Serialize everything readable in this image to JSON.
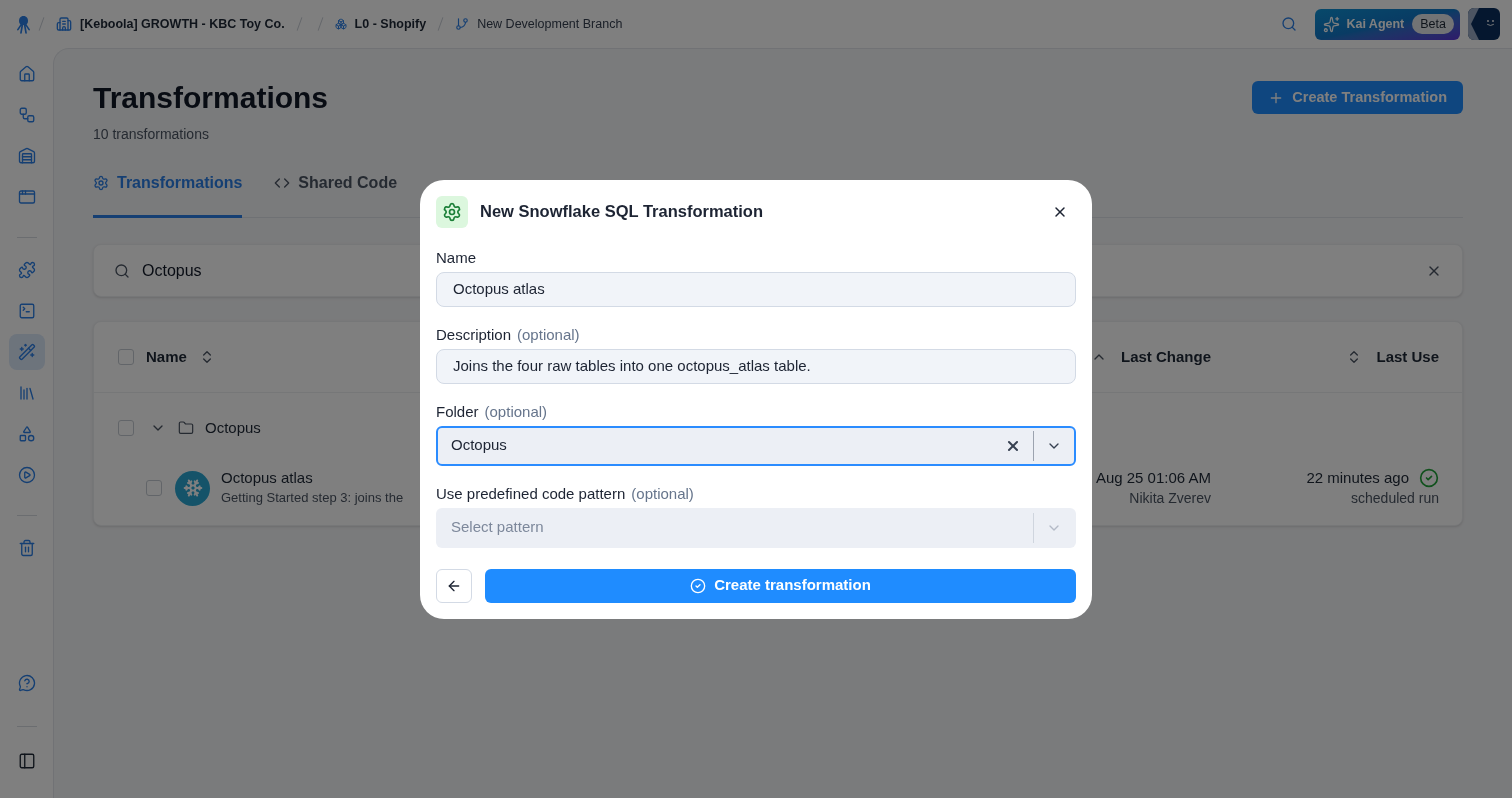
{
  "topbar": {
    "breadcrumbs": [
      {
        "kind": "project",
        "label": "[Keboola] GROWTH - KBC Toy Co."
      },
      {
        "kind": "configuration",
        "label": "L0 - Shopify"
      },
      {
        "kind": "branch",
        "label": "New Development Branch"
      }
    ],
    "agent_button": {
      "label": "Kai Agent",
      "badge": "Beta"
    }
  },
  "sidebar": {
    "top_groups": [
      [
        {
          "kind": "home",
          "selected": false
        },
        {
          "kind": "flows",
          "selected": false
        },
        {
          "kind": "storage",
          "selected": false
        },
        {
          "kind": "workspaces",
          "selected": false
        }
      ],
      [
        {
          "kind": "components",
          "selected": false
        },
        {
          "kind": "terminal",
          "selected": false
        },
        {
          "kind": "transformations",
          "selected": true
        },
        {
          "kind": "library",
          "selected": false
        },
        {
          "kind": "shapes",
          "selected": false
        },
        {
          "kind": "jobs",
          "selected": false
        }
      ],
      [
        {
          "kind": "trash",
          "selected": false
        }
      ]
    ],
    "bottom_groups": [
      [
        {
          "kind": "help"
        }
      ],
      [
        {
          "kind": "panel"
        }
      ]
    ]
  },
  "page": {
    "title": "Transformations",
    "subtitle": "10 transformations",
    "create_button": "Create Transformation"
  },
  "tabs": [
    {
      "kind": "gear",
      "label": "Transformations",
      "selected": true
    },
    {
      "kind": "code",
      "label": "Shared Code",
      "selected": false
    }
  ],
  "search": {
    "value": "Octopus"
  },
  "table": {
    "select_all_checked": false,
    "columns": [
      {
        "label": "Name",
        "sorted": false
      },
      {
        "label": "Last Change",
        "sorted": true,
        "descending": false
      },
      {
        "label": "Last Use",
        "sorted": false
      }
    ],
    "rows": [
      {
        "kind": "folder",
        "name": "Octopus",
        "checked": false,
        "expanded": true,
        "children": [
          {
            "kind": "snowflake",
            "name": "Octopus atlas",
            "description": "Getting Started step 3: joins the",
            "last_change": "Aug 25 01:06 AM",
            "changed_by": "Nikita Zverev",
            "last_use": "22 minutes ago",
            "last_use_note": "scheduled run",
            "succeeded": true,
            "checked": false
          }
        ]
      }
    ]
  },
  "dialog": {
    "title": "New Snowflake SQL Transformation",
    "fields": [
      {
        "kind": "text",
        "label": "Name",
        "value": "Octopus atlas"
      },
      {
        "kind": "text",
        "label": "Description",
        "note": "(optional)",
        "value": "Joins the four raw tables into one octopus_atlas table."
      },
      {
        "kind": "select",
        "label": "Folder",
        "note": "(optional)",
        "value": "Octopus",
        "focused": true
      },
      {
        "kind": "select",
        "label": "Use predefined code pattern",
        "note": "(optional)",
        "placeholder": "Select pattern",
        "focused": false
      }
    ],
    "submit": "Create transformation"
  }
}
